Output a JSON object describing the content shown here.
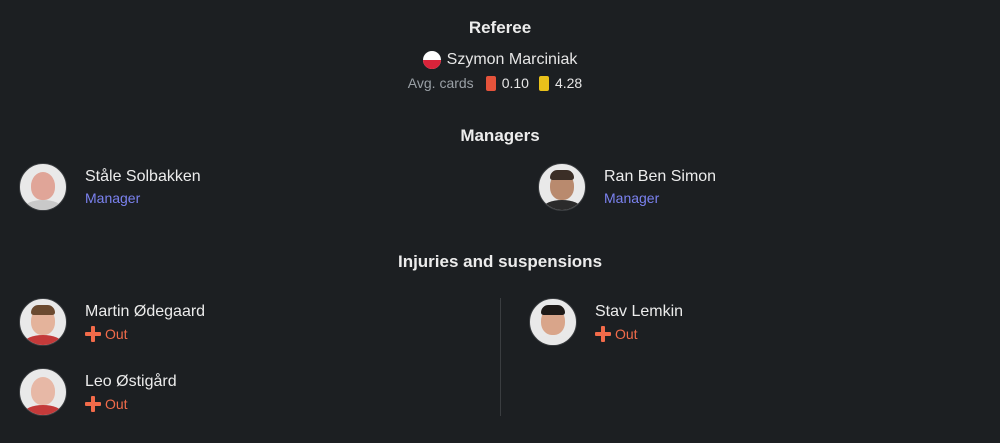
{
  "referee": {
    "heading": "Referee",
    "name": "Szymon Marciniak",
    "flag_icon": "poland-flag-icon",
    "avg_cards_label": "Avg. cards",
    "red_avg": "0.10",
    "yellow_avg": "4.28"
  },
  "managers": {
    "heading": "Managers",
    "home": {
      "name": "Ståle Solbakken",
      "role": "Manager"
    },
    "away": {
      "name": "Ran Ben Simon",
      "role": "Manager"
    }
  },
  "injuries": {
    "heading": "Injuries and suspensions",
    "home": [
      {
        "name": "Martin Ødegaard",
        "status": "Out"
      },
      {
        "name": "Leo Østigård",
        "status": "Out"
      }
    ],
    "away": [
      {
        "name": "Stav Lemkin",
        "status": "Out"
      }
    ]
  },
  "colors": {
    "background": "#1c1f22",
    "manager_role": "#7b82f0",
    "status_out": "#f26b4a",
    "red_card": "#e5533b",
    "yellow_card": "#e9c11a"
  }
}
